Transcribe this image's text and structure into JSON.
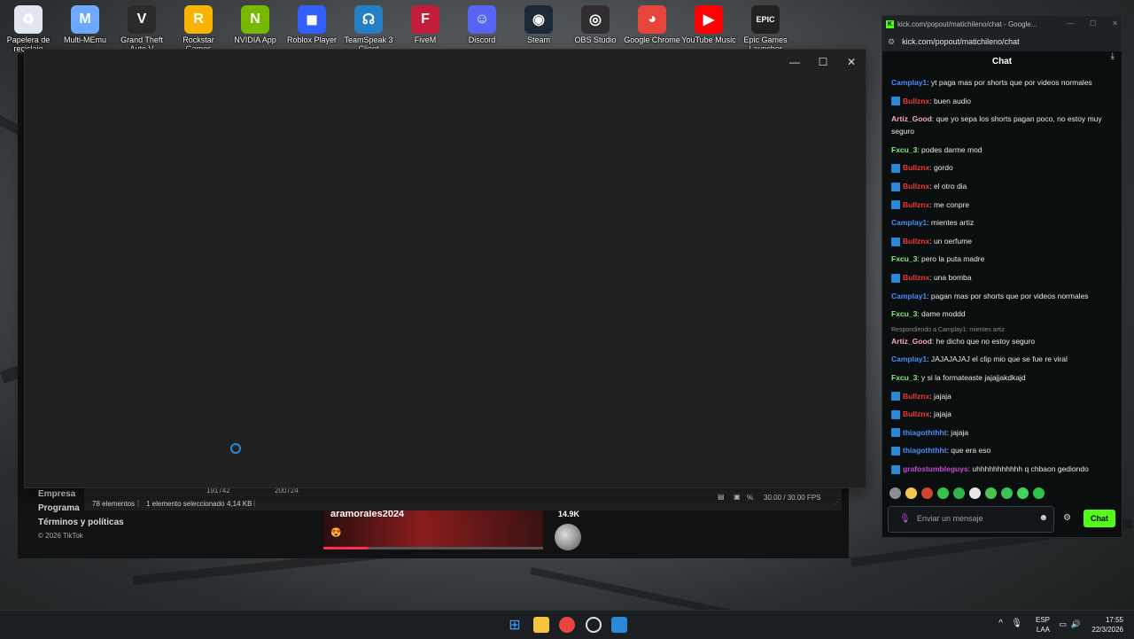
{
  "desktop": {
    "icons": [
      {
        "label": "Papelera de reciclaje",
        "icon": "recycle-bin-icon",
        "color": "#dfe6ee"
      },
      {
        "label": "Multi-MEmu",
        "icon": "memu-icon",
        "color": "#6fa8ff"
      },
      {
        "label": "Grand Theft Auto V",
        "icon": "gta-icon",
        "color": "#2b2b2b"
      },
      {
        "label": "Rockstar Games Launcher",
        "icon": "rockstar-icon",
        "color": "#f8b400"
      },
      {
        "label": "NVIDIA App",
        "icon": "nvidia-icon",
        "color": "#76b900"
      },
      {
        "label": "Roblox Player",
        "icon": "roblox-icon",
        "color": "#335fff"
      },
      {
        "label": "TeamSpeak 3 Client",
        "icon": "teamspeak-icon",
        "color": "#2580c3"
      },
      {
        "label": "FiveM",
        "icon": "fivem-icon",
        "color": "#c21e3c"
      },
      {
        "label": "Discord",
        "icon": "discord-icon",
        "color": "#5865f2"
      },
      {
        "label": "Steam",
        "icon": "steam-icon",
        "color": "#1b2838"
      },
      {
        "label": "OBS Studio",
        "icon": "obs-icon",
        "color": "#302e31"
      },
      {
        "label": "Google Chrome",
        "icon": "chrome-icon",
        "color": "#e8453c"
      },
      {
        "label": "YouTube Music",
        "icon": "youtube-music-icon",
        "color": "#ff0000"
      },
      {
        "label": "Epic Games Launcher",
        "icon": "epic-games-icon",
        "color": "#222222"
      }
    ],
    "glyphs": [
      "♻",
      "M",
      "V",
      "R",
      "N",
      "◼",
      "☊",
      "F",
      "☺",
      "◉",
      "◎",
      "◕",
      "▶",
      "EPIC"
    ]
  },
  "background_page": {
    "footer_links": [
      "Empresa",
      "Programa",
      "Términos y políticas"
    ],
    "copyright": "© 2026 TikTok",
    "card_name": "aramorales2024",
    "card_emoji": "😍",
    "count": "14.9K",
    "progress": 0.2
  },
  "explorer_status": {
    "col1": "191742",
    "col2": "200724",
    "items": "78 elementos",
    "selected": "1 elemento seleccionado",
    "size": "4,14 KB",
    "fps": "30.00 / 30.00 FPS",
    "percent": "%"
  },
  "main_window": {
    "minimize": "—",
    "maximize": "☐",
    "close": "✕"
  },
  "chat": {
    "title_bar": "kick.com/popout/matichileno/chat - Google...",
    "url": "kick.com/popout/matichileno/chat",
    "header": "Chat",
    "user_colors": {
      "Camplay1": "#4b8cf7",
      "Bullznx": "#f03a3a",
      "Artiz_Good": "#f4a7b9",
      "Fxcu_3": "#7ef07e",
      "thiagoththht": "#4b8cf7",
      "grafostumbleguys": "#c14ed6"
    },
    "messages": [
      {
        "user": "Camplay1",
        "text": ": yt paga mas por shorts que por videos normales",
        "badge": false
      },
      {
        "user": "Bullznx",
        "text": ": buen audio",
        "badge": true
      },
      {
        "user": "Artiz_Good",
        "text": ": que yo sepa los shorts pagan poco, no estoy muy seguro",
        "badge": false
      },
      {
        "user": "Fxcu_3",
        "text": ": podes darme mod",
        "badge": false
      },
      {
        "user": "Bullznx",
        "text": ": gordo",
        "badge": true
      },
      {
        "user": "Bullznx",
        "text": ": el otro dia",
        "badge": true
      },
      {
        "user": "Bullznx",
        "text": ": me conpre",
        "badge": true
      },
      {
        "user": "Camplay1",
        "text": ": mientes artiz",
        "badge": false
      },
      {
        "user": "Bullznx",
        "text": ": un oerfume",
        "badge": true
      },
      {
        "user": "Fxcu_3",
        "text": ": pero la puta madre",
        "badge": false
      },
      {
        "user": "Bullznx",
        "text": ": una bomba",
        "badge": true
      },
      {
        "user": "Camplay1",
        "text": ": pagan mas por shorts que por videos normales",
        "badge": false
      },
      {
        "user": "Fxcu_3",
        "text": ": dame moddd",
        "badge": false
      },
      {
        "user": "Artiz_Good",
        "text": ": he dicho que no estoy seguro",
        "badge": false,
        "reply": "Respondiendo a Camplay1: mientes artiz"
      },
      {
        "user": "Camplay1",
        "text": ": JAJAJAJAJ el clip mio que se fue re viral",
        "badge": false
      },
      {
        "user": "Fxcu_3",
        "text": ": y si la formateaste jajajjakdkajd",
        "badge": false
      },
      {
        "user": "Bullznx",
        "text": ": jajaja",
        "badge": true
      },
      {
        "user": "Bullznx",
        "text": ": jajaja",
        "badge": true
      },
      {
        "user": "thiagoththht",
        "text": ": jajaja",
        "badge": true
      },
      {
        "user": "thiagoththht",
        "text": ": que era eso",
        "badge": true
      },
      {
        "user": "grafostumbleguys",
        "text": ": uhhhhhhhhhhh q chbaon gediondo",
        "badge": true
      }
    ],
    "emote_colors": [
      "#8a8f94",
      "#f2c94c",
      "#d0452f",
      "#36c24a",
      "#2fb34a",
      "#e6e6e6",
      "#4cc24f",
      "#3fbf55",
      "#43d35a",
      "#2ec24a"
    ],
    "input_placeholder": "Enviar un mensaje",
    "send_label": "Chat"
  },
  "taskbar": {
    "language": "ESP",
    "layout": "LAA",
    "time": "17:55",
    "date": "22/3/2026",
    "tray_chevron": "^"
  }
}
